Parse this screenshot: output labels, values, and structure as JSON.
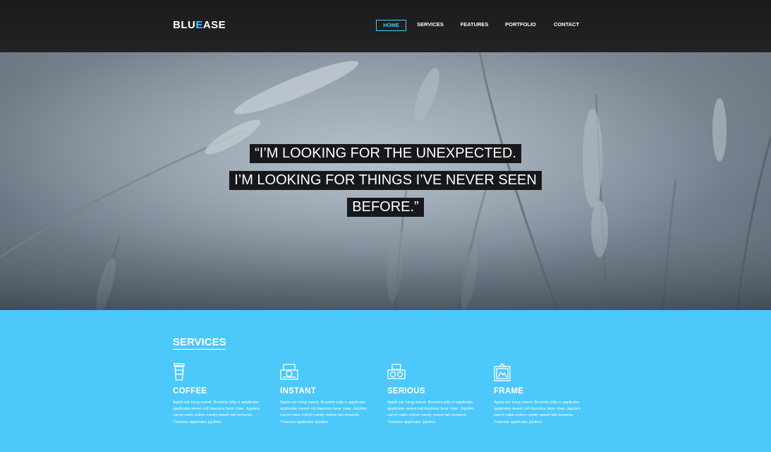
{
  "header": {
    "logo_part1": "BLU",
    "logo_part2": "E",
    "logo_part3": "ASE",
    "nav": [
      {
        "label": "HOME",
        "active": true
      },
      {
        "label": "SERVICES",
        "active": false
      },
      {
        "label": "FEATURES",
        "active": false
      },
      {
        "label": "PORTFOLIO",
        "active": false
      },
      {
        "label": "CONTACT",
        "active": false
      }
    ]
  },
  "hero": {
    "quote_lines": [
      "“I’M LOOKING FOR THE UNEXPECTED.",
      " I’M LOOKING FOR THINGS I’VE NEVER SEEN",
      "BEFORE.”"
    ]
  },
  "services": {
    "title": "SERVICES",
    "items": [
      {
        "icon": "coffee-cup-icon",
        "title": "COFFEE",
        "text": "Apple pie icing sweet. Brownie jelly-o applicake applicake sweet roll liquorice bear claw. Jujubes carrot cake cotton candy sweet tart brownie. Tiramisu applicake jujubes."
      },
      {
        "icon": "instant-camera-icon",
        "title": "INSTANT",
        "text": "Apple pie icing sweet. Brownie jelly-o applicake applicake sweet roll liquorice bear claw. Jujubes carrot cake cotton candy sweet tart brownie. Tiramisu applicake jujubes."
      },
      {
        "icon": "camera-icon",
        "title": "SERIOUS",
        "text": "Apple pie icing sweet. Brownie jelly-o applicake applicake sweet roll liquorice bear claw. Jujubes carrot cake cotton candy sweet tart brownie. Tiramisu applicake jujubes."
      },
      {
        "icon": "frame-icon",
        "title": "FRAME",
        "text": "Apple pie icing sweet. Brownie jelly-o applicake applicake sweet roll liquorice bear claw. Jujubes carrot cake cotton candy sweet tart brownie. Tiramisu applicake jujubes."
      }
    ]
  },
  "colors": {
    "accent": "#4cc8fb",
    "header_bg": "#1a1b1d",
    "quote_bg": "#16181b"
  }
}
